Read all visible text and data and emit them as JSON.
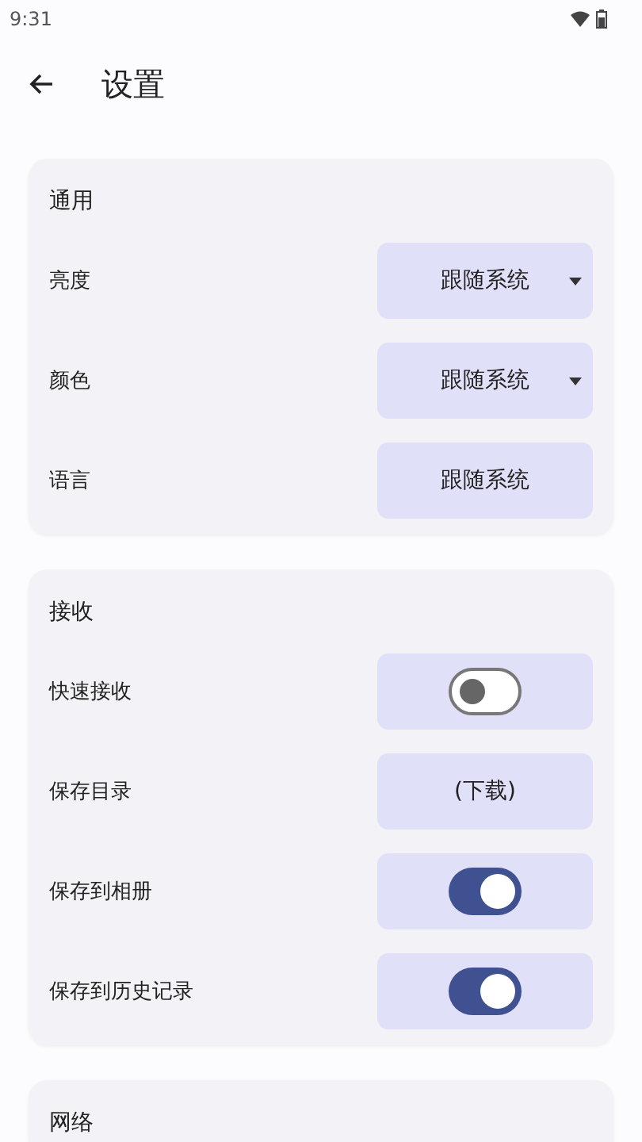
{
  "status_bar": {
    "time": "9:31"
  },
  "app_bar": {
    "title": "设置"
  },
  "sections": [
    {
      "title": "通用",
      "items": [
        {
          "label": "亮度",
          "kind": "dropdown",
          "value": "跟随系统"
        },
        {
          "label": "颜色",
          "kind": "dropdown",
          "value": "跟随系统"
        },
        {
          "label": "语言",
          "kind": "button",
          "value": "跟随系统"
        }
      ]
    },
    {
      "title": "接收",
      "items": [
        {
          "label": "快速接收",
          "kind": "switch",
          "on": false
        },
        {
          "label": "保存目录",
          "kind": "button",
          "value": "(下载)"
        },
        {
          "label": "保存到相册",
          "kind": "switch",
          "on": true
        },
        {
          "label": "保存到历史记录",
          "kind": "switch",
          "on": true
        }
      ]
    },
    {
      "title": "网络"
    }
  ]
}
